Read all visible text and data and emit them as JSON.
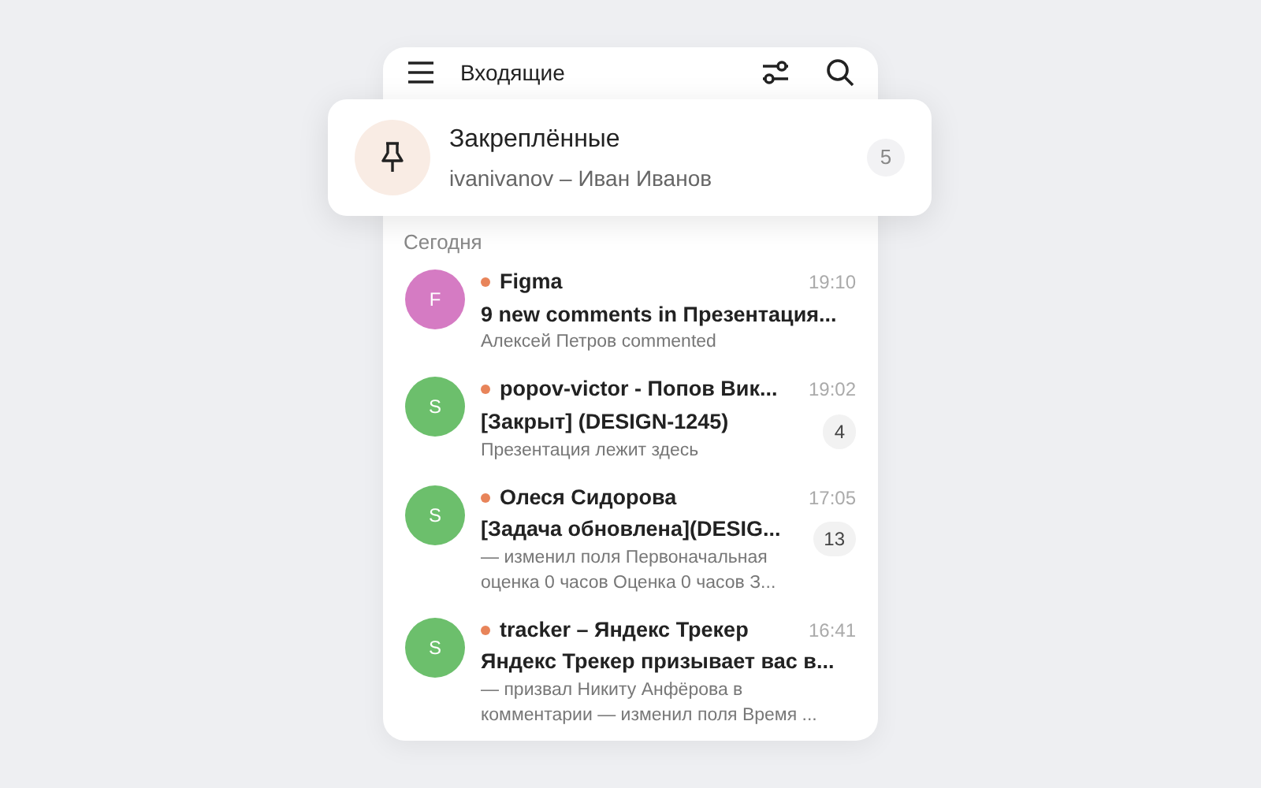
{
  "header": {
    "title": "Входящие"
  },
  "pinned": {
    "title": "Закреплённые",
    "subtitle": "ivanivanov – Иван Иванов",
    "count": "5"
  },
  "section": "Сегодня",
  "messages": [
    {
      "avatar": "F",
      "color": "#d57bc3",
      "unread": true,
      "sender": "Figma",
      "time": "19:10",
      "subject": "9 new comments in Презентация...",
      "preview": [
        "Алексей Петров commented"
      ]
    },
    {
      "avatar": "S",
      "color": "#6cbf6c",
      "unread": true,
      "sender": "popov-victor - Попов Вик...",
      "time": "19:02",
      "subject": "[Закрыт] (DESIGN-1245)",
      "preview": [
        "Презентация лежит здесь"
      ],
      "count": "4"
    },
    {
      "avatar": "S",
      "color": "#6cbf6c",
      "unread": true,
      "sender": "Олеся Сидорова",
      "time": "17:05",
      "subject": "[Задача обновлена](DESIG...",
      "preview": [
        "— изменил поля Первоначальная",
        "оценка 0 часов Оценка 0 часов З..."
      ],
      "count": "13"
    },
    {
      "avatar": "S",
      "color": "#6cbf6c",
      "unread": true,
      "sender": "tracker – Яндекс Трекер",
      "time": "16:41",
      "subject": "Яндекс Трекер призывает вас в...",
      "preview": [
        "— призвал Никиту Анфёрова в",
        "комментарии — изменил поля Время ..."
      ]
    }
  ]
}
